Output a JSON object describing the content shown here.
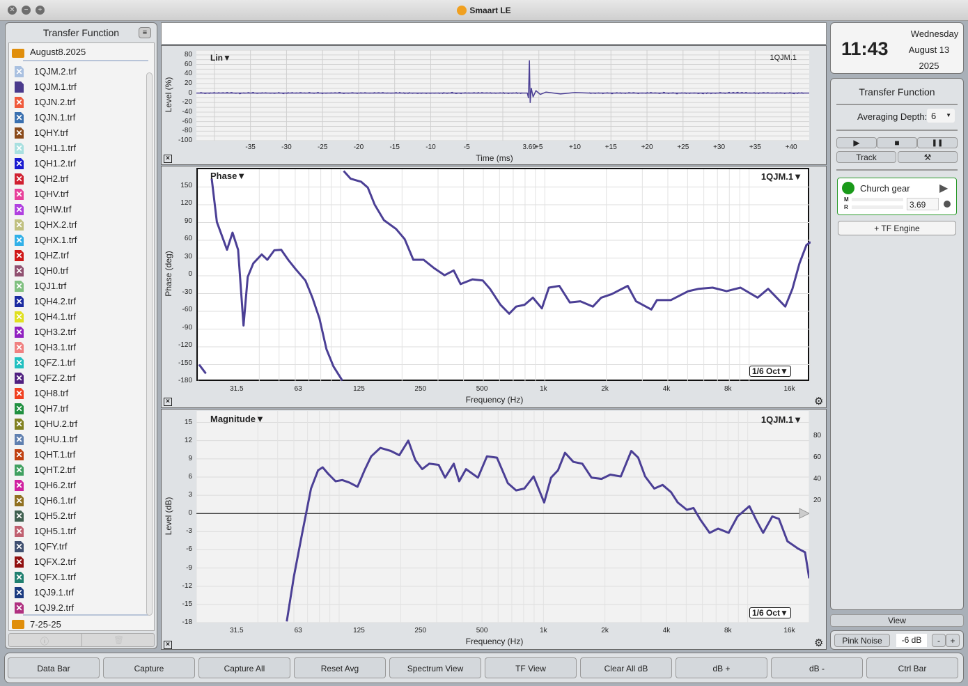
{
  "window": {
    "title": "Smaart LE",
    "close": "✕",
    "minimize": "−",
    "zoom": "+"
  },
  "left_panel": {
    "title": "Transfer Function",
    "menu_icon": "menu-icon",
    "folder": "August8.2025",
    "folder2": "7-25-25",
    "files": [
      {
        "name": "1QJM.2.trf",
        "color": "#a9c0e0"
      },
      {
        "name": "1QJM.1.trf",
        "color": "#4a3a8c",
        "active": true
      },
      {
        "name": "1QJN.2.trf",
        "color": "#f05a3c"
      },
      {
        "name": "1QJN.1.trf",
        "color": "#3a70b0"
      },
      {
        "name": "1QHY.trf",
        "color": "#8a4a1a"
      },
      {
        "name": "1QH1.1.trf",
        "color": "#a8e0e0"
      },
      {
        "name": "1QH1.2.trf",
        "color": "#1a1ad0"
      },
      {
        "name": "1QH2.trf",
        "color": "#d02030"
      },
      {
        "name": "1QHV.trf",
        "color": "#e8409a"
      },
      {
        "name": "1QHW.trf",
        "color": "#b040e0"
      },
      {
        "name": "1QHX.2.trf",
        "color": "#c0c080"
      },
      {
        "name": "1QHX.1.trf",
        "color": "#30b0e8"
      },
      {
        "name": "1QHZ.trf",
        "color": "#d01818"
      },
      {
        "name": "1QH0.trf",
        "color": "#905070"
      },
      {
        "name": "1QJ1.trf",
        "color": "#80c080"
      },
      {
        "name": "1QH4.2.trf",
        "color": "#1a2aa0"
      },
      {
        "name": "1QH4.1.trf",
        "color": "#e0e020"
      },
      {
        "name": "1QH3.2.trf",
        "color": "#9020c0"
      },
      {
        "name": "1QH3.1.trf",
        "color": "#f08080"
      },
      {
        "name": "1QFZ.1.trf",
        "color": "#20c0c0"
      },
      {
        "name": "1QFZ.2.trf",
        "color": "#502080"
      },
      {
        "name": "1QH8.trf",
        "color": "#f04020"
      },
      {
        "name": "1QH7.trf",
        "color": "#209040"
      },
      {
        "name": "1QHU.2.trf",
        "color": "#808020"
      },
      {
        "name": "1QHU.1.trf",
        "color": "#6080b0"
      },
      {
        "name": "1QHT.1.trf",
        "color": "#c04010"
      },
      {
        "name": "1QHT.2.trf",
        "color": "#40a060"
      },
      {
        "name": "1QH6.2.trf",
        "color": "#d020a0"
      },
      {
        "name": "1QH6.1.trf",
        "color": "#907020"
      },
      {
        "name": "1QH5.2.trf",
        "color": "#406050"
      },
      {
        "name": "1QH5.1.trf",
        "color": "#c06070"
      },
      {
        "name": "1QFY.trf",
        "color": "#405070"
      },
      {
        "name": "1QFX.2.trf",
        "color": "#901010"
      },
      {
        "name": "1QFX.1.trf",
        "color": "#208070"
      },
      {
        "name": "1QJ9.1.trf",
        "color": "#1a3a80"
      },
      {
        "name": "1QJ9.2.trf",
        "color": "#b03080"
      }
    ],
    "info_icon": "ⓘ",
    "trash_icon": "🗑"
  },
  "clock": {
    "time": "11:43",
    "weekday": "Wednesday",
    "date": "August 13",
    "year": "2025"
  },
  "tf_panel": {
    "title": "Transfer Function",
    "averaging_label": "Averaging Depth:",
    "averaging_value": "6",
    "play": "▶",
    "stop": "■",
    "pause": "❚❚",
    "track": "Track",
    "tools": "⚒",
    "engine": {
      "name": "Church gear",
      "m": "M",
      "r": "R",
      "delay": "3.69",
      "status_color": "#1a9a1a"
    },
    "add_engine": "+ TF Engine",
    "view": "View",
    "pink_noise": "Pink Noise",
    "level": "-6 dB",
    "minus": "-",
    "plus": "+"
  },
  "bottom_bar": [
    "Data Bar",
    "Capture",
    "Capture All",
    "Reset Avg",
    "Spectrum View",
    "TF View",
    "Clear All dB",
    "dB +",
    "dB -",
    "Ctrl Bar"
  ],
  "trace_color": "#4b3f95",
  "chart_data": [
    {
      "type": "line",
      "name": "impulse",
      "mode_label": "Lin▼",
      "trace_label": "1QJM.1",
      "xlabel": "Time (ms)",
      "ylabel": "Level (%)",
      "xlim": [
        -42.5,
        42.5
      ],
      "ylim": [
        -100,
        90
      ],
      "xticks": [
        "-35",
        "-30",
        "-25",
        "-20",
        "-15",
        "-10",
        "-5",
        "3.69",
        "+5",
        "+10",
        "+15",
        "+20",
        "+25",
        "+30",
        "+35",
        "+40"
      ],
      "xtick_values": [
        -35,
        -30,
        -25,
        -20,
        -15,
        -10,
        -5,
        3.69,
        5,
        10,
        15,
        20,
        25,
        30,
        35,
        40
      ],
      "yticks": [
        80,
        60,
        40,
        20,
        0,
        -20,
        -40,
        -60,
        -80,
        -100
      ],
      "x": [
        -42.5,
        3.4,
        3.55,
        3.69,
        3.8,
        3.95,
        4.2,
        4.6,
        5.2,
        6,
        8,
        10,
        12,
        42.5
      ],
      "y": [
        0,
        0,
        -10,
        68,
        -20,
        10,
        -8,
        5,
        -3,
        2,
        -2,
        1,
        0,
        0
      ]
    },
    {
      "type": "line",
      "name": "phase",
      "mode_label": "Phase▼",
      "trace_label": "1QJM.1▼",
      "smoothing": "1/6 Oct▼",
      "xlabel": "Frequency (Hz)",
      "ylabel": "Phase (deg)",
      "xscale": "log",
      "xlim": [
        20,
        20000
      ],
      "ylim": [
        -180,
        180
      ],
      "xticks": [
        "31.5",
        "63",
        "125",
        "250",
        "500",
        "1k",
        "2k",
        "4k",
        "8k",
        "16k"
      ],
      "xtick_values": [
        31.5,
        63,
        125,
        250,
        500,
        1000,
        2000,
        4000,
        8000,
        16000
      ],
      "yticks": [
        150,
        120,
        90,
        60,
        30,
        0,
        -30,
        -60,
        -90,
        -120,
        -150,
        -180
      ],
      "segments": [
        {
          "x": [
            20.3,
            21.9
          ],
          "y": [
            -150,
            -165
          ]
        },
        {
          "x": [
            23.4,
            24.8,
            27.8,
            29.6,
            31.5,
            33.5,
            35.1,
            37.4,
            41.1,
            43.8,
            47.4,
            51.2,
            55.4,
            60,
            67.3,
            72.8,
            78.8,
            85.3,
            92.3,
            102
          ],
          "y": [
            164,
            91,
            44,
            73,
            44,
            -84,
            -2,
            21,
            36,
            27,
            43,
            44,
            27,
            12,
            -8,
            -37,
            -72,
            -124,
            -153,
            -177
          ]
        },
        {
          "x": [
            103.6,
            112,
            126,
            136,
            147,
            163,
            187,
            206,
            227,
            255,
            287,
            323,
            358,
            387,
            442,
            497,
            539,
            606,
            669,
            724,
            796,
            874,
            967,
            1047,
            1178,
            1326,
            1493,
            1719,
            1888,
            2125,
            2545,
            2794,
            3322,
            3536,
            4136,
            5036,
            5666,
            6626,
            7752,
            9070,
            11010,
            12390,
            15030,
            16300,
            17640,
            19080,
            20000
          ],
          "y": [
            177,
            164,
            159,
            149,
            120,
            94,
            79,
            62,
            27,
            27,
            13,
            1,
            9,
            -14,
            -6,
            -8,
            -22,
            -49,
            -64,
            -52,
            -49,
            -37,
            -55,
            -20,
            -17,
            -45,
            -43,
            -52,
            -37,
            -31,
            -17,
            -43,
            -57,
            -41,
            -41,
            -26,
            -22,
            -20,
            -26,
            -20,
            -37,
            -22,
            -52,
            -22,
            21,
            52,
            57
          ]
        }
      ]
    },
    {
      "type": "line",
      "name": "magnitude",
      "mode_label": "Magnitude▼",
      "trace_label": "1QJM.1▼",
      "smoothing": "1/6 Oct▼",
      "xlabel": "Frequency (Hz)",
      "ylabel": "Level (dB)",
      "xscale": "log",
      "xlim": [
        20,
        20000
      ],
      "ylim": [
        -18,
        16.9
      ],
      "xticks": [
        "31.5",
        "63",
        "125",
        "250",
        "500",
        "1k",
        "2k",
        "4k",
        "8k",
        "16k"
      ],
      "xtick_values": [
        31.5,
        63,
        125,
        250,
        500,
        1000,
        2000,
        4000,
        8000,
        16000
      ],
      "yticks": [
        15,
        12,
        9,
        6,
        3,
        0,
        -3,
        -6,
        -9,
        -12,
        -15,
        -18
      ],
      "right_yticks": [
        80,
        60,
        40,
        20
      ],
      "right_ytick_values": [
        80,
        60,
        40,
        20
      ],
      "x": [
        55.4,
        60,
        65.8,
        72.8,
        78.8,
        83,
        88.5,
        96,
        103.6,
        112,
        123,
        133,
        143.5,
        159,
        179,
        197,
        218,
        236,
        255,
        276,
        307,
        330,
        364,
        387,
        418,
        478,
        529,
        592,
        669,
        735,
        806,
        895,
        1008,
        1090,
        1178,
        1275,
        1401,
        1550,
        1719,
        1925,
        2125,
        2392,
        2691,
        2910,
        3146,
        3487,
        3832,
        4213,
        4545,
        5036,
        5426,
        5883,
        6510,
        7164,
        8064,
        8913,
        10190,
        11010,
        11890,
        13180,
        14220,
        15650,
        17640,
        19080,
        20000
      ],
      "y": [
        -17.8,
        -10.4,
        -3.4,
        4.1,
        7.1,
        7.6,
        6.5,
        5.3,
        5.5,
        5.1,
        4.4,
        7.1,
        9.4,
        10.8,
        10.3,
        9.6,
        12,
        8.8,
        7.3,
        8.2,
        8,
        5.9,
        8.2,
        5.3,
        7.3,
        5.9,
        9.4,
        9.2,
        5,
        3.8,
        4.1,
        6.1,
        1.8,
        5.9,
        7.1,
        10,
        8.5,
        8.2,
        5.9,
        5.7,
        6.4,
        6.1,
        10.3,
        9.2,
        6.1,
        4.1,
        4.7,
        3.5,
        1.8,
        0.6,
        0.9,
        -1.1,
        -3.2,
        -2.5,
        -3.2,
        -0.5,
        1.2,
        -1.1,
        -3.2,
        -0.5,
        -0.9,
        -4.6,
        -5.8,
        -6.4,
        -10.7
      ]
    }
  ]
}
